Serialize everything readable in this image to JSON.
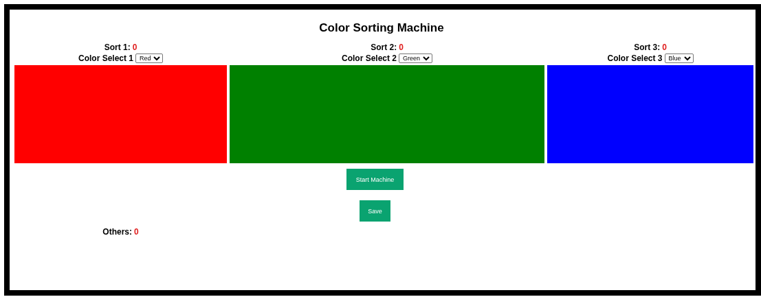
{
  "title": "Color Sorting Machine",
  "sorters": [
    {
      "label": "Sort 1:",
      "count": "0",
      "select_label": "Color Select 1",
      "value": "Red",
      "color": "#ff0000"
    },
    {
      "label": "Sort 2:",
      "count": "0",
      "select_label": "Color Select 2",
      "value": "Green",
      "color": "#008000"
    },
    {
      "label": "Sort 3:",
      "count": "0",
      "select_label": "Color Select 3",
      "value": "Blue",
      "color": "#0000ff"
    }
  ],
  "buttons": [
    "Start Machine",
    "Save"
  ],
  "others": {
    "label": "Others:",
    "count": "0"
  }
}
